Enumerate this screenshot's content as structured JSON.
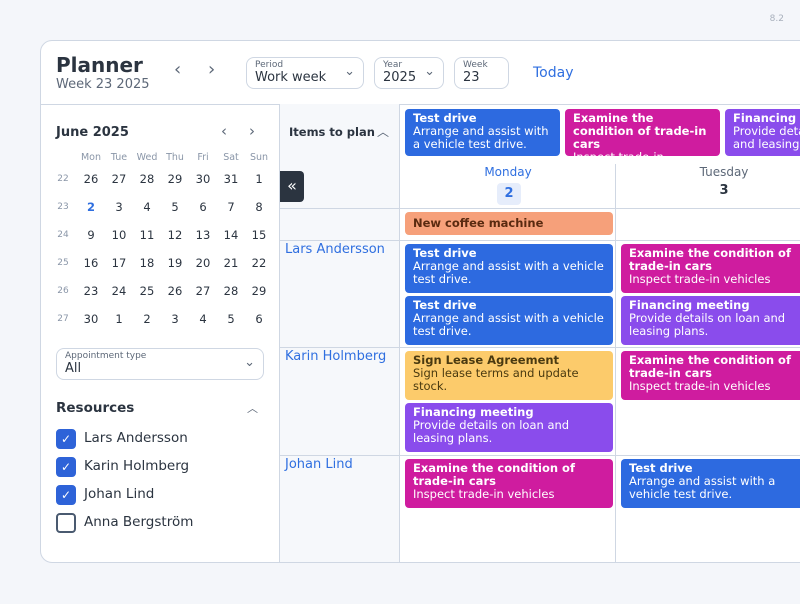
{
  "version": "8.2",
  "header": {
    "title": "Planner",
    "subtitle": "Week 23 2025",
    "prev": "‹",
    "next": "›",
    "period": {
      "label": "Period",
      "value": "Work week"
    },
    "year": {
      "label": "Year",
      "value": "2025"
    },
    "week": {
      "label": "Week",
      "value": "23"
    },
    "today": "Today"
  },
  "calendar": {
    "title": "June 2025",
    "weekdays": [
      "Mon",
      "Tue",
      "Wed",
      "Thu",
      "Fri",
      "Sat",
      "Sun"
    ],
    "weeks": [
      {
        "n": "22",
        "days": [
          "26",
          "27",
          "28",
          "29",
          "30",
          "31",
          "1"
        ]
      },
      {
        "n": "23",
        "days": [
          "2",
          "3",
          "4",
          "5",
          "6",
          "7",
          "8"
        ]
      },
      {
        "n": "24",
        "days": [
          "9",
          "10",
          "11",
          "12",
          "13",
          "14",
          "15"
        ]
      },
      {
        "n": "25",
        "days": [
          "16",
          "17",
          "18",
          "19",
          "20",
          "21",
          "22"
        ]
      },
      {
        "n": "26",
        "days": [
          "23",
          "24",
          "25",
          "26",
          "27",
          "28",
          "29"
        ]
      },
      {
        "n": "27",
        "days": [
          "30",
          "1",
          "2",
          "3",
          "4",
          "5",
          "6"
        ]
      }
    ],
    "selected": "2"
  },
  "filter": {
    "label": "Appointment type",
    "value": "All"
  },
  "resources": {
    "title": "Resources",
    "items": [
      {
        "name": "Lars Andersson",
        "checked": true
      },
      {
        "name": "Karin Holmberg",
        "checked": true
      },
      {
        "name": "Johan Lind",
        "checked": true
      },
      {
        "name": "Anna Bergström",
        "checked": false
      }
    ]
  },
  "planner": {
    "items_label": "Items to plan",
    "unplanned": [
      {
        "title": "Test drive",
        "desc": "Arrange and assist with a vehicle test drive.",
        "color": "#2d6ae0"
      },
      {
        "title": "Examine the condition of trade-in cars",
        "desc": "Inspect trade-in vehicles",
        "color": "#cf1c9f"
      },
      {
        "title": "Financing meeting",
        "desc": "Provide details on loan and leasing plans.",
        "color": "#8a4cec"
      }
    ],
    "days": [
      {
        "name": "Monday",
        "num": "2"
      },
      {
        "name": "Tuesday",
        "num": "3"
      }
    ],
    "allday": {
      "title": "New coffee machine installation",
      "color": "#f6a07a"
    },
    "rows": [
      {
        "resource": "Lars Andersson",
        "mon": [
          {
            "title": "Test drive",
            "desc": "Arrange and assist with a vehicle test drive."
          },
          {
            "title": "Test drive",
            "desc": "Arrange and assist with a vehicle test drive."
          }
        ],
        "tue": [
          {
            "title": "Examine the condition of trade-in cars",
            "desc": "Inspect trade-in vehicles"
          },
          {
            "title": "Financing meeting",
            "desc": "Provide details on loan and leasing plans."
          }
        ]
      },
      {
        "resource": "Karin Holmberg",
        "mon": [
          {
            "title": "Sign Lease Agreement",
            "desc": "Sign lease terms and update stock."
          },
          {
            "title": "Financing meeting",
            "desc": "Provide details on loan and leasing plans."
          }
        ],
        "tue": [
          {
            "title": "Examine the condition of trade-in cars",
            "desc": "Inspect trade-in vehicles"
          }
        ]
      },
      {
        "resource": "Johan Lind",
        "mon": [
          {
            "title": "Examine the condition of trade-in cars",
            "desc": "Inspect trade-in vehicles"
          }
        ],
        "tue": [
          {
            "title": "Test drive",
            "desc": "Arrange and assist with a vehicle test drive."
          }
        ]
      }
    ]
  }
}
